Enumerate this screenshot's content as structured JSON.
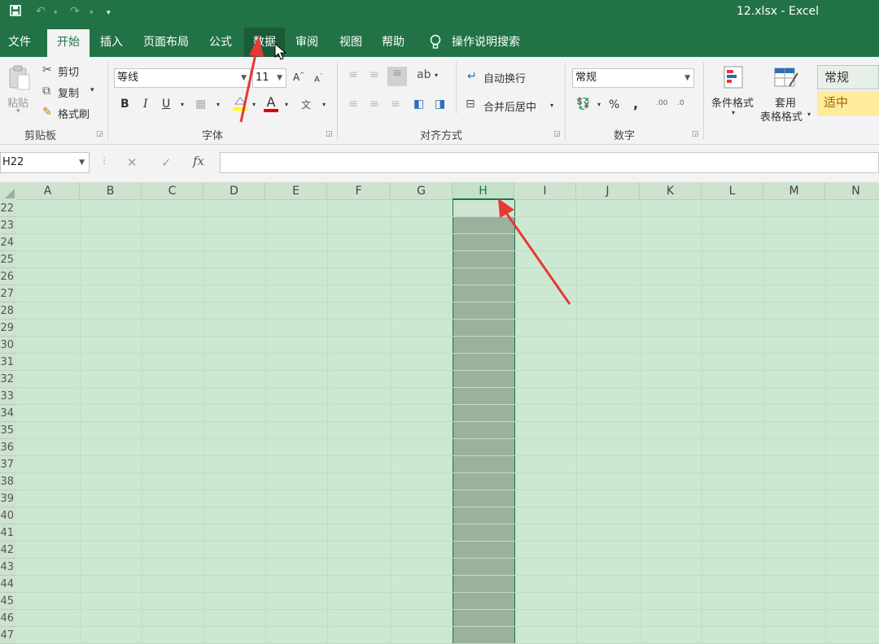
{
  "titlebar": {
    "save_icon": "save-icon",
    "undo_icon": "undo-icon",
    "redo_icon": "redo-icon",
    "title": "12.xlsx  -  Excel"
  },
  "tabs": [
    {
      "label": "文件"
    },
    {
      "label": "开始"
    },
    {
      "label": "插入"
    },
    {
      "label": "页面布局"
    },
    {
      "label": "公式"
    },
    {
      "label": "数据"
    },
    {
      "label": "审阅"
    },
    {
      "label": "视图"
    },
    {
      "label": "帮助"
    },
    {
      "label": "操作说明搜索"
    }
  ],
  "clipboard": {
    "paste": "粘贴",
    "cut": "剪切",
    "copy": "复制",
    "format_painter": "格式刷",
    "group": "剪贴板"
  },
  "font": {
    "name": "等线",
    "size": "11",
    "bold": "B",
    "italic": "I",
    "underline": "U",
    "color_letter": "A",
    "group": "字体"
  },
  "alignment": {
    "wrap": "自动换行",
    "merge": "合并后居中",
    "group": "对齐方式"
  },
  "number": {
    "format": "常规",
    "percent": "%",
    "comma": ",",
    "group": "数字"
  },
  "styles": {
    "conditional": "条件格式",
    "table_l1": "套用",
    "table_l2": "表格格式",
    "normal": "常规",
    "neutral": "适中"
  },
  "formula_bar": {
    "name_box": "H22",
    "cancel": "✕",
    "enter": "✓",
    "fx": "fx",
    "value": ""
  },
  "columns": [
    "A",
    "B",
    "C",
    "D",
    "E",
    "F",
    "G",
    "H",
    "I",
    "J",
    "K",
    "L",
    "M",
    "N"
  ],
  "rows": [
    "22",
    "23",
    "24",
    "25",
    "26",
    "27",
    "28",
    "29",
    "30",
    "31",
    "32",
    "33",
    "34",
    "35",
    "36",
    "37",
    "38",
    "39",
    "40",
    "41",
    "42",
    "43",
    "44",
    "45",
    "46",
    "47"
  ],
  "selected_column": "H",
  "colors": {
    "excel_green": "#217346",
    "annotation_red": "#e53935"
  }
}
